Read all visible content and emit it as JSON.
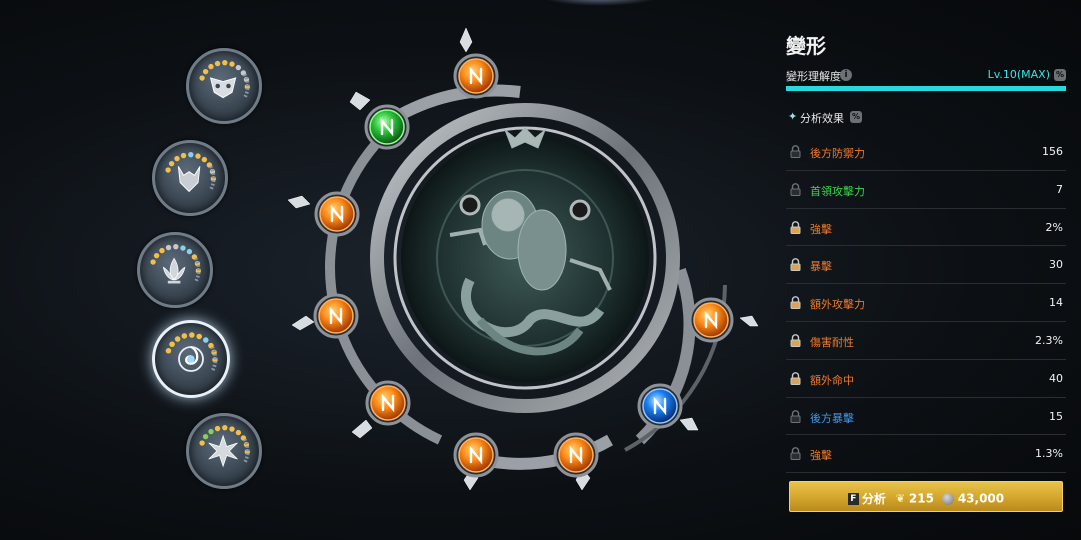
{
  "panel": {
    "title": "變形",
    "understanding_label": "變形理解度",
    "info_icon": "i",
    "level_value": "Lv.10(MAX)",
    "percent_icon": "%",
    "progress_fraction": 1.0,
    "section_star": "✦",
    "section_label": "分析效果",
    "section_icon": "%",
    "stats": [
      {
        "name": "後方防禦力",
        "value": "156",
        "color": "orange",
        "locked": true
      },
      {
        "name": "首領攻擊力",
        "value": "7",
        "color": "green",
        "locked": true
      },
      {
        "name": "強擊",
        "value": "2%",
        "color": "orange",
        "locked": false
      },
      {
        "name": "暴擊",
        "value": "30",
        "color": "orange",
        "locked": false
      },
      {
        "name": "額外攻擊力",
        "value": "14",
        "color": "orange",
        "locked": false
      },
      {
        "name": "傷害耐性",
        "value": "2.3%",
        "color": "orange",
        "locked": false
      },
      {
        "name": "額外命中",
        "value": "40",
        "color": "orange",
        "locked": false
      },
      {
        "name": "後方暴擊",
        "value": "15",
        "color": "blue",
        "locked": true
      },
      {
        "name": "強擊",
        "value": "1.3%",
        "color": "orange",
        "locked": true
      }
    ],
    "button": {
      "key": "F",
      "label": "分析",
      "feather_icon": "feather-icon",
      "feather_count": "215",
      "coin_icon": "coin-icon",
      "coin_count": "43,000"
    }
  },
  "colors": {
    "accent_cyan": "#27d8dc",
    "orange": "#f07a2a",
    "green": "#3ad64a",
    "blue": "#3a9cf0",
    "button_gold": "#d4a52c"
  },
  "medallions": [
    {
      "icon": "mask-icon",
      "selected": false
    },
    {
      "icon": "wolf-icon",
      "selected": false
    },
    {
      "icon": "lotus-icon",
      "selected": false
    },
    {
      "icon": "vortex-icon",
      "selected": true
    },
    {
      "icon": "star-flower-icon",
      "selected": false
    }
  ],
  "wheel": {
    "center_icon": "beast-emblem-icon",
    "nodes": [
      {
        "icon": "rune-icon",
        "color": "orange"
      },
      {
        "icon": "rune-icon",
        "color": "green"
      },
      {
        "icon": "rune-icon",
        "color": "orange"
      },
      {
        "icon": "rune-icon",
        "color": "orange"
      },
      {
        "icon": "rune-icon",
        "color": "orange"
      },
      {
        "icon": "rune-icon",
        "color": "orange"
      },
      {
        "icon": "rune-icon",
        "color": "orange"
      },
      {
        "icon": "rune-icon",
        "color": "blue"
      },
      {
        "icon": "rune-icon",
        "color": "orange"
      }
    ]
  }
}
